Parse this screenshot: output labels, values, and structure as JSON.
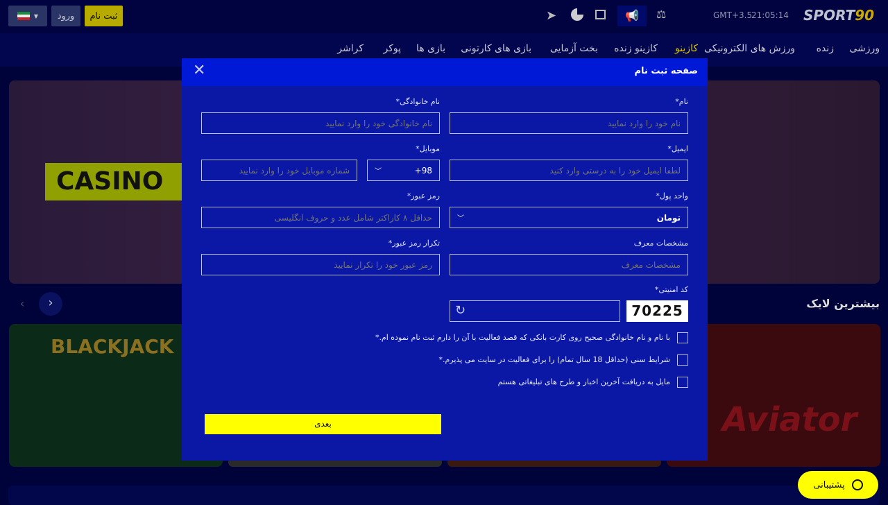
{
  "header": {
    "register": "ثبت نام",
    "login": "ورود",
    "timezone": "GMT+3.5",
    "time": "21:05:14",
    "logo": "SPORT90",
    "accent": "#f5e600"
  },
  "nav": [
    "ورزشی",
    "زنده",
    "ورزش های الکترونیکی",
    "کازینو",
    "کازینو زنده",
    "بخت آزمایی",
    "بازی های کارتونی",
    "بازی ها",
    "پوکر",
    "کراشر"
  ],
  "nav_active": "کازینو",
  "sections": {
    "most_liked": "بیشترین لایک",
    "banner_text": "CASINO",
    "game1": "BLACKJACK",
    "game2": "Aviator"
  },
  "support": "پشتیبانی",
  "modal": {
    "title": "صفحه ثبت نام",
    "first_name": {
      "label": "نام*",
      "placeholder": "نام خود را وارد نمایید"
    },
    "last_name": {
      "label": "نام خانوادگی*",
      "placeholder": "نام خانوادگی خود را وارد نمایید"
    },
    "email": {
      "label": "ایمیل*",
      "placeholder": "لطفا ایمیل خود را به درستی وارد کنید"
    },
    "mobile": {
      "label": "موبایل*",
      "code": "+98",
      "placeholder": "شماره موبایل خود را وارد نمایید"
    },
    "currency": {
      "label": "واحد پول*",
      "value": "تومان"
    },
    "password": {
      "label": "رمز عبور*",
      "placeholder": "حداقل ۸ کاراکتر شامل عدد و حروف انگلیسی"
    },
    "referrer": {
      "label": "مشخصات معرف",
      "placeholder": "مشخصات معرف"
    },
    "password_repeat": {
      "label": "تکرار رمز عبور*",
      "placeholder": "رمز عبور خود را تکرار نمایید"
    },
    "captcha": {
      "label": "کد امنیتی*",
      "code": "70225"
    },
    "checks": [
      "با نام و نام خانوادگی صحیح روی کارت بانکی که قصد فعالیت با آن را دارم ثبت نام نموده ام.*",
      "شرایط سنی (حداقل 18 سال تمام) را برای فعالیت در سایت می پذیرم.*",
      "مایل به دریافت آخرین اخبار و طرح های تبلیغاتی هستم"
    ],
    "next": "بعدی"
  }
}
